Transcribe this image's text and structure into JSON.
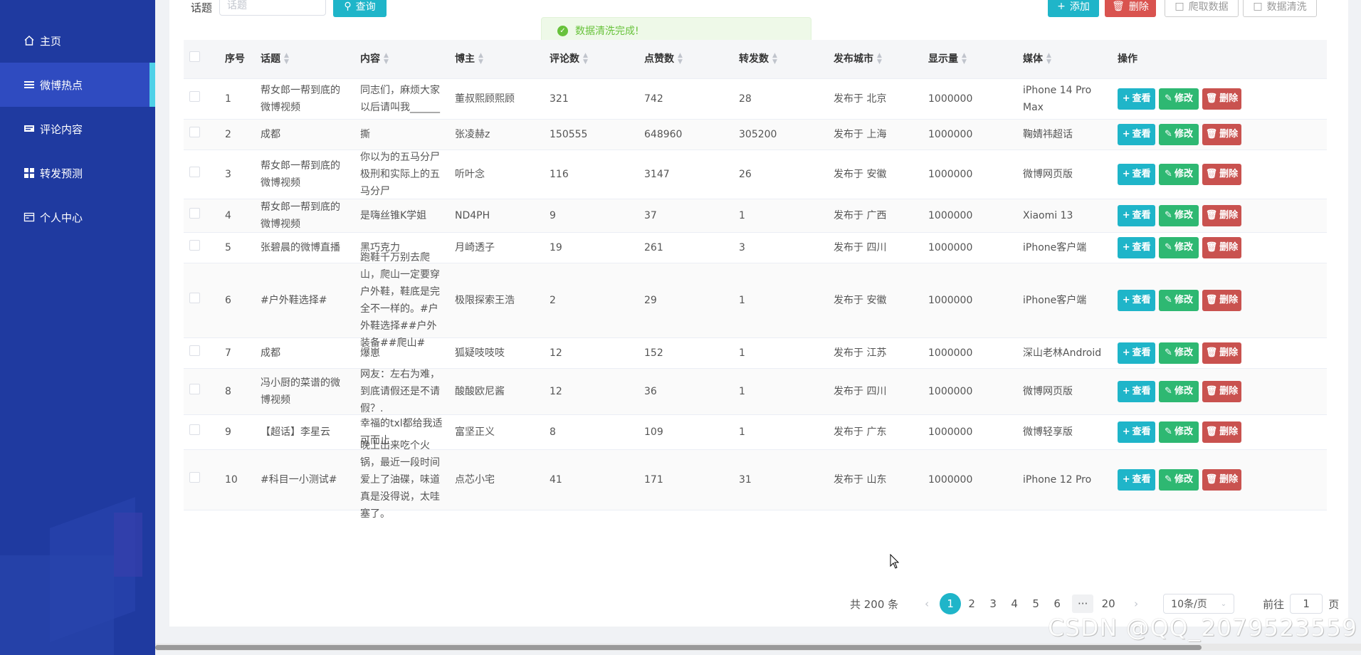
{
  "sidebar": {
    "items": [
      {
        "label": "主页",
        "icon": "home-icon"
      },
      {
        "label": "微博热点",
        "icon": "list-icon"
      },
      {
        "label": "评论内容",
        "icon": "comment-icon"
      },
      {
        "label": "转发预测",
        "icon": "grid-icon"
      },
      {
        "label": "个人中心",
        "icon": "profile-card-icon"
      }
    ],
    "active_index": 1
  },
  "toolbar": {
    "search_label": "话题",
    "search_placeholder": "话题",
    "query_label": "查询",
    "add_label": "添加",
    "delete_label": "删除",
    "crawl_label": "爬取数据",
    "clean_label": "数据清洗"
  },
  "toast": {
    "message": "数据清洗完成!"
  },
  "table": {
    "headers": [
      "序号",
      "话题",
      "内容",
      "博主",
      "评论数",
      "点赞数",
      "转发数",
      "发布城市",
      "显示量",
      "媒体",
      "操作"
    ],
    "rows": [
      {
        "no": "1",
        "topic": "帮女郎一帮到底的微博视频",
        "content": "同志们，麻烦大家以后请叫我______",
        "author": "董叔熙顾熙顾",
        "comments": "321",
        "likes": "742",
        "forwards": "28",
        "city": "发布于 北京",
        "views": "1000000",
        "media": "iPhone 14 Pro Max"
      },
      {
        "no": "2",
        "topic": "成都",
        "content": "撕",
        "author": "张凌赫z",
        "comments": "150555",
        "likes": "648960",
        "forwards": "305200",
        "city": "发布于 上海",
        "views": "1000000",
        "media": "鞠婧祎超话"
      },
      {
        "no": "3",
        "topic": "帮女郎一帮到底的微博视频",
        "content": "你以为的五马分尸极刑和实际上的五马分尸",
        "author": "听叶念",
        "comments": "116",
        "likes": "3147",
        "forwards": "26",
        "city": "发布于 安徽",
        "views": "1000000",
        "media": "微博网页版"
      },
      {
        "no": "4",
        "topic": "帮女郎一帮到底的微博视频",
        "content": "是嗨丝锥K学姐",
        "author": "ND4PH",
        "comments": "9",
        "likes": "37",
        "forwards": "1",
        "city": "发布于 广西",
        "views": "1000000",
        "media": "Xiaomi 13"
      },
      {
        "no": "5",
        "topic": "张碧晨的微博直播",
        "content": "黑巧克力",
        "author": "月崎透子",
        "comments": "19",
        "likes": "261",
        "forwards": "3",
        "city": "发布于 四川",
        "views": "1000000",
        "media": "iPhone客户端"
      },
      {
        "no": "6",
        "topic": "#户外鞋选择#",
        "content": "跑鞋千万别去爬山，爬山一定要穿户外鞋，鞋底是完全不一样的。#户外鞋选择##户外装备##爬山#",
        "author": "极限探索王浩",
        "comments": "2",
        "likes": "29",
        "forwards": "1",
        "city": "发布于 安徽",
        "views": "1000000",
        "media": "iPhone客户端"
      },
      {
        "no": "7",
        "topic": "成都",
        "content": "爆崽",
        "author": "狐疑吱吱吱",
        "comments": "12",
        "likes": "152",
        "forwards": "1",
        "city": "发布于 江苏",
        "views": "1000000",
        "media": "深山老林Android"
      },
      {
        "no": "8",
        "topic": "冯小厨的菜谱的微博视频",
        "content": "网友：左右为难，到底请假还是不请假？.",
        "author": "酸酸欧尼酱",
        "comments": "12",
        "likes": "36",
        "forwards": "1",
        "city": "发布于 四川",
        "views": "1000000",
        "media": "微博网页版"
      },
      {
        "no": "9",
        "topic": "【超话】李星云",
        "content": "幸福的txl都给我适可而止",
        "author": "富坚正义",
        "comments": "8",
        "likes": "109",
        "forwards": "1",
        "city": "发布于 广东",
        "views": "1000000",
        "media": "微博轻享版"
      },
      {
        "no": "10",
        "topic": "#科目一小测试#",
        "content": "晚上出来吃个火锅，最近一段时间爱上了油碟，味道真是没得说，太哇塞了。",
        "author": "点芯小宅",
        "comments": "41",
        "likes": "171",
        "forwards": "31",
        "city": "发布于 山东",
        "views": "1000000",
        "media": "iPhone 12 Pro"
      }
    ],
    "actions": {
      "view": "查看",
      "edit": "修改",
      "delete": "删除"
    }
  },
  "pagination": {
    "total": "共 200 条",
    "prev": "‹",
    "next": "›",
    "pages": [
      "1",
      "2",
      "3",
      "4",
      "5",
      "6"
    ],
    "ellipsis": "···",
    "last": "20",
    "current": "1",
    "page_size": "10条/页",
    "goto_prefix": "前往",
    "goto_value": "1",
    "goto_suffix": "页"
  },
  "watermark": "CSDN @QQ_2079523559",
  "colors": {
    "sidebar": "#1f3aa0",
    "accent": "#1fb5c9",
    "success": "#2eb872",
    "danger": "#c9524f"
  }
}
